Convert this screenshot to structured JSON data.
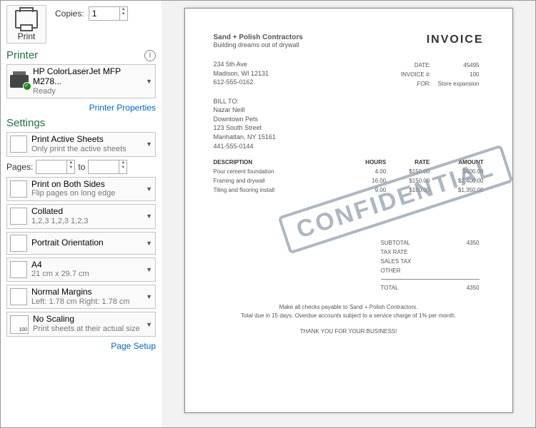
{
  "left": {
    "print": "Print",
    "copies_label": "Copies:",
    "copies_value": "1",
    "printer_hdr": "Printer",
    "printer_name": "HP ColorLaserJet MFP M278...",
    "printer_status": "Ready",
    "printer_props": "Printer Properties",
    "settings_hdr": "Settings",
    "s1a": "Print Active Sheets",
    "s1b": "Only print the active sheets",
    "pages_label": "Pages:",
    "pages_to": "to",
    "s2a": "Print on Both Sides",
    "s2b": "Flip pages on long edge",
    "s3a": "Collated",
    "s3b": "1,2,3   1,2,3   1,2,3",
    "s4a": "Portrait Orientation",
    "s5a": "A4",
    "s5b": "21 cm x 29.7 cm",
    "s6a": "Normal Margins",
    "s6b": "Left:  1.78 cm    Right:  1.78 cm",
    "s7a": "No Scaling",
    "s7b": "Print sheets at their actual size",
    "page_setup": "Page Setup"
  },
  "inv": {
    "company": "Sand + Polish Contractors",
    "tagline": "Building dreams out of drywall",
    "title": "INVOICE",
    "addr1": "234 5th Ave",
    "addr2": "Madison, WI 12131",
    "addr3": "612-555-0162",
    "m1k": "DATE:",
    "m1v": "45495",
    "m2k": "INVOICE #:",
    "m2v": "100",
    "m3k": "FOR:",
    "m3v": "Store expansion",
    "billto_h": "BILL TO:",
    "b1": "Nazar Neill",
    "b2": "Downtown Pets",
    "b3": "123 South Street",
    "b4": "Manhattan, NY 15161",
    "b5": "441-555-0144",
    "th1": "DESCRIPTION",
    "th2": "HOURS",
    "th3": "RATE",
    "th4": "AMOUNT",
    "r1d": "Pour cement foundation",
    "r1h": "4.00",
    "r1r": "$150.00",
    "r1a": "$600.00",
    "r2d": "Framing and drywall",
    "r2h": "16.00",
    "r2r": "$150.00",
    "r2a": "$2,400.00",
    "r3d": "Tiling and flooring install",
    "r3h": "9.00",
    "r3r": "$150.00",
    "r3a": "$1,350.00",
    "t1k": "SUBTOTAL",
    "t1v": "4350",
    "t2k": "TAX RATE",
    "t3k": "SALES TAX",
    "t4k": "OTHER",
    "t5k": "TOTAL",
    "t5v": "4350",
    "stamp": "CONFIDENTIAL",
    "f1": "Make all checks payable to Sand + Polish Contractors.",
    "f2": "Total due in 15 days. Overdue accounts subject to a service charge of 1% per month.",
    "f3": "THANK YOU FOR YOUR BUSINESS!"
  }
}
